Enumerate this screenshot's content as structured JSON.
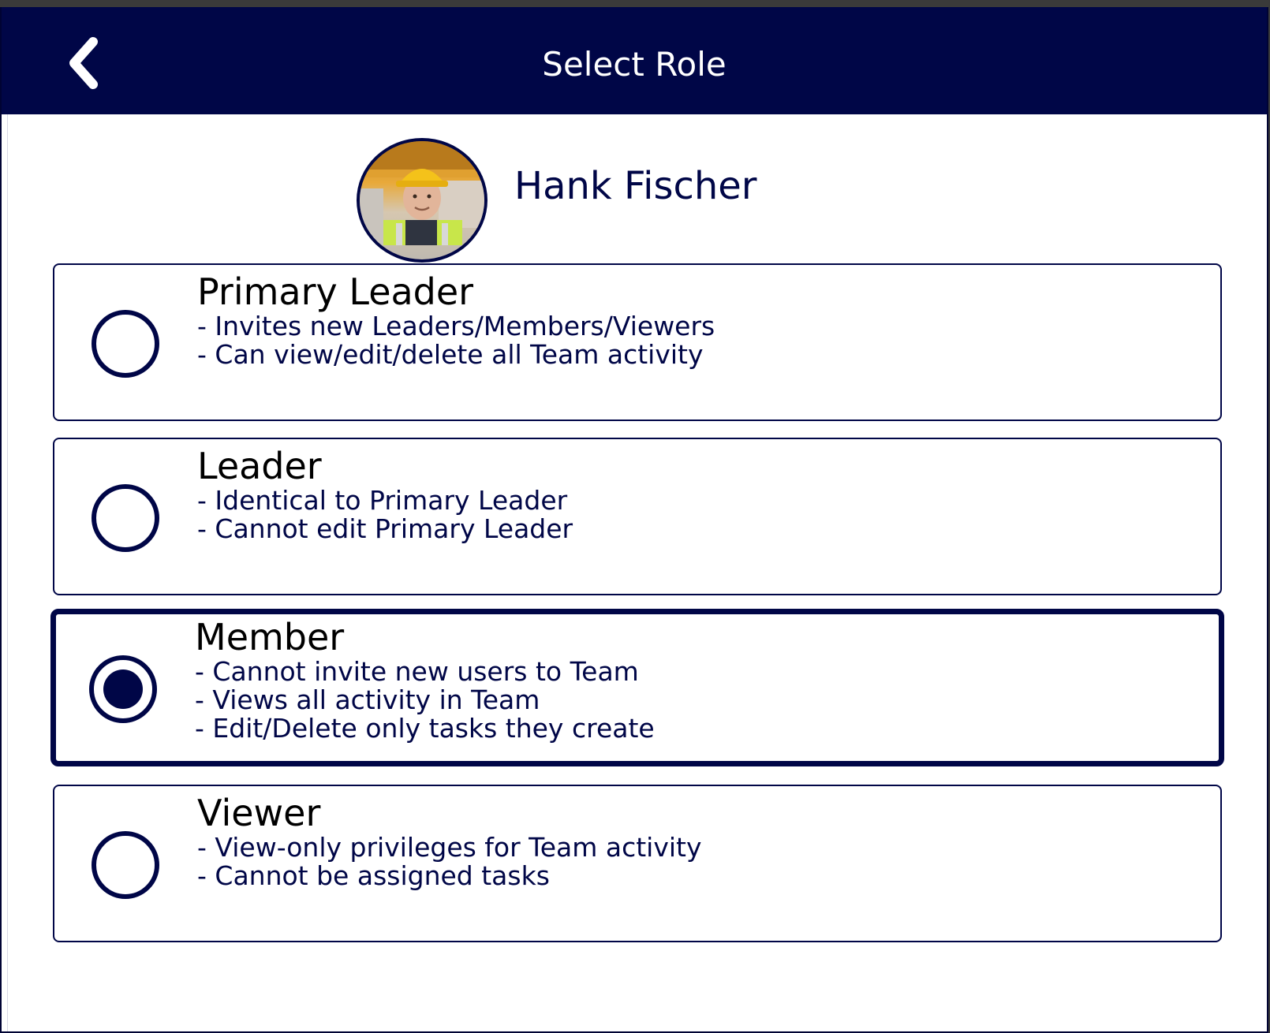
{
  "header": {
    "title": "Select Role",
    "back_icon": "chevron-left-icon"
  },
  "colors": {
    "primary": "#000647",
    "background": "#ffffff",
    "title_text": "#000000"
  },
  "profile": {
    "name": "Hank Fischer",
    "avatar": "worker-photo-avatar"
  },
  "roles": [
    {
      "title": "Primary Leader",
      "selected": false,
      "lines": [
        "- Invites new Leaders/Members/Viewers",
        "- Can view/edit/delete all Team activity"
      ]
    },
    {
      "title": "Leader",
      "selected": false,
      "lines": [
        "- Identical to Primary Leader",
        "- Cannot edit Primary Leader"
      ]
    },
    {
      "title": "Member",
      "selected": true,
      "lines": [
        "- Cannot invite new users to Team",
        "- Views all activity in Team",
        "- Edit/Delete only tasks they create"
      ]
    },
    {
      "title": "Viewer",
      "selected": false,
      "lines": [
        "- View-only privileges for Team activity",
        "- Cannot be assigned tasks"
      ]
    }
  ]
}
